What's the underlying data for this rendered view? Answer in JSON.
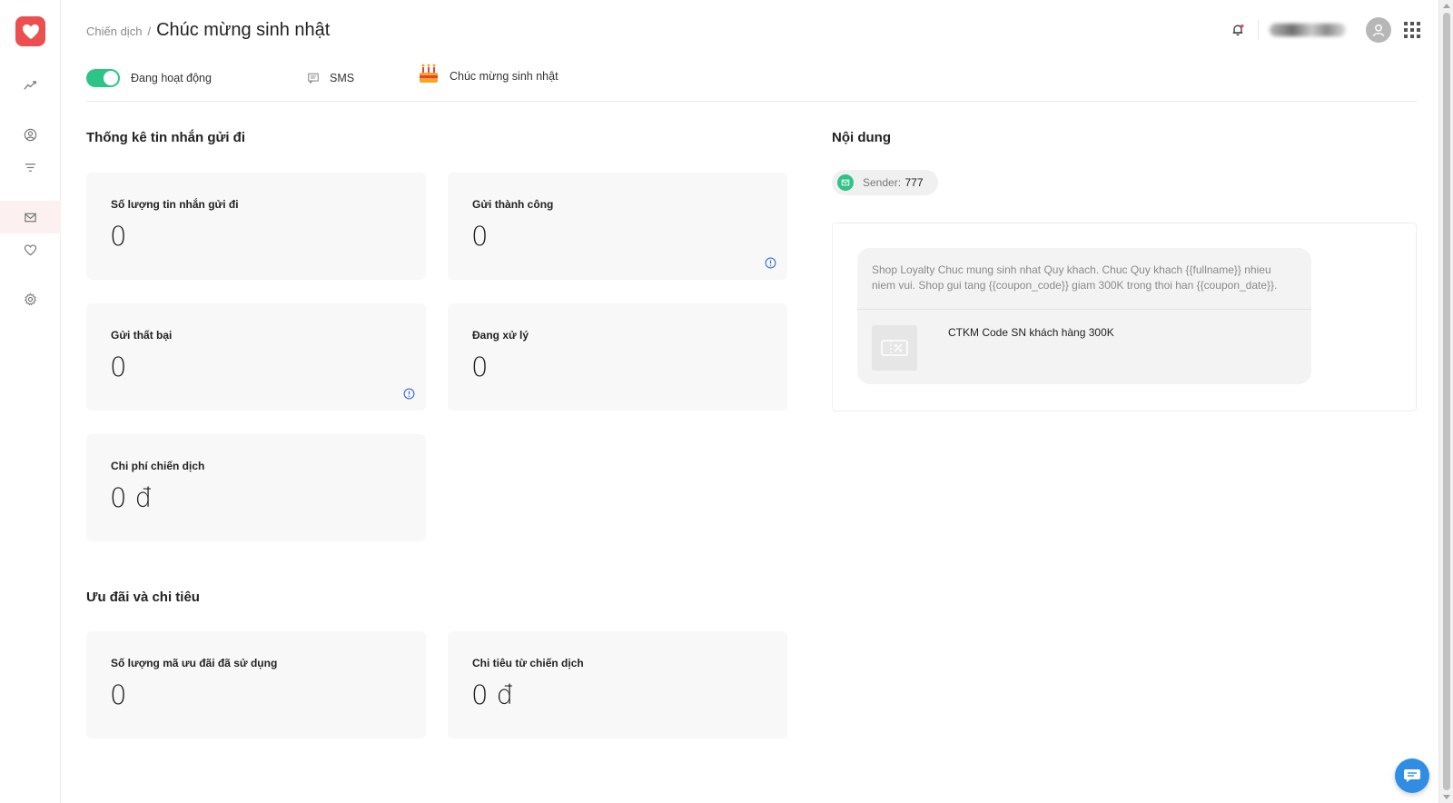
{
  "breadcrumb": {
    "parent": "Chiến dịch",
    "separator": "/",
    "title": "Chúc mừng sinh nhật"
  },
  "status": {
    "active_label": "Đang hoạt động",
    "channel_label": "SMS",
    "campaign_type": "Chúc mừng sinh nhật",
    "active": true
  },
  "stats": {
    "section_title": "Thống kê tin nhắn gửi đi",
    "cards": [
      {
        "label": "Số lượng tin nhắn gửi đi",
        "value": "0"
      },
      {
        "label": "Gửi thành công",
        "value": "0"
      },
      {
        "label": "Gửi thất bại",
        "value": "0"
      },
      {
        "label": "Đang xử lý",
        "value": "0"
      },
      {
        "label": "Chi phí chiến dịch",
        "value": "0 đ"
      }
    ]
  },
  "offers": {
    "section_title": "Ưu đãi và chi tiêu",
    "cards": [
      {
        "label": "Số lượng mã ưu đãi đã sử dụng",
        "value": "0"
      },
      {
        "label": "Chi tiêu từ chiến dịch",
        "value": "0 đ"
      }
    ]
  },
  "content": {
    "section_title": "Nội dung",
    "sender_key": "Sender:",
    "sender_value": "777",
    "message": "Shop Loyalty Chuc mung sinh nhat Quy khach. Chuc Quy khach {{fullname}} nhieu niem vui. Shop gui tang {{coupon_code}} giam 300K trong thoi han {{coupon_date}}.",
    "coupon_name": "CTKM Code SN khách hàng 300K"
  },
  "colors": {
    "brand": "#ec4f4f",
    "toggle_on": "#2ec486",
    "info": "#3a6fd8",
    "chat": "#2f8ee3"
  },
  "icons": {
    "sidebar": [
      "analytics-icon",
      "user-circle-icon",
      "filter-icon",
      "mail-icon",
      "heart-icon",
      "gear-icon"
    ],
    "header": [
      "bell-icon",
      "avatar-icon",
      "apps-grid-icon"
    ]
  }
}
